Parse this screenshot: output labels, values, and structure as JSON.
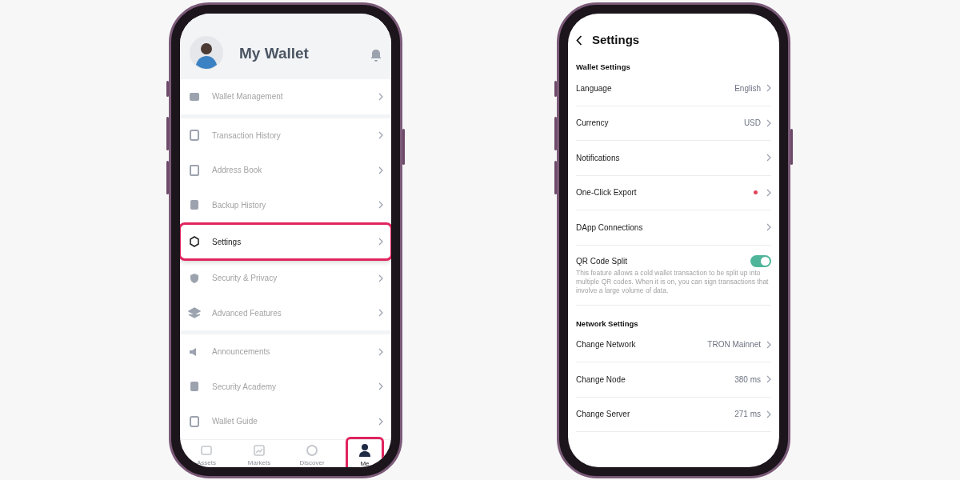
{
  "wallet_screen": {
    "title": "My Wallet",
    "items": [
      {
        "label": "Wallet Management",
        "selected": false,
        "group_end": true
      },
      {
        "label": "Transaction History",
        "selected": false,
        "group_end": false
      },
      {
        "label": "Address Book",
        "selected": false,
        "group_end": false
      },
      {
        "label": "Backup History",
        "selected": false,
        "group_end": false
      },
      {
        "label": "Settings",
        "selected": true,
        "group_end": false
      },
      {
        "label": "Security & Privacy",
        "selected": false,
        "group_end": false
      },
      {
        "label": "Advanced Features",
        "selected": false,
        "group_end": true
      },
      {
        "label": "Announcements",
        "selected": false,
        "group_end": false
      },
      {
        "label": "Security Academy",
        "selected": false,
        "group_end": false
      },
      {
        "label": "Wallet Guide",
        "selected": false,
        "group_end": false
      }
    ],
    "tabs": [
      {
        "label": "Assets",
        "selected": false
      },
      {
        "label": "Markets",
        "selected": false
      },
      {
        "label": "Discover",
        "selected": false
      },
      {
        "label": "Me",
        "selected": true
      }
    ]
  },
  "settings_screen": {
    "title": "Settings",
    "sections": [
      {
        "heading": "Wallet Settings",
        "rows": [
          {
            "kind": "link",
            "label": "Language",
            "value": "English"
          },
          {
            "kind": "link",
            "label": "Currency",
            "value": "USD"
          },
          {
            "kind": "link",
            "label": "Notifications"
          },
          {
            "kind": "dot",
            "label": "One-Click Export",
            "color": "#e0435a"
          },
          {
            "kind": "link",
            "label": "DApp Connections"
          },
          {
            "kind": "toggle",
            "label": "QR Code Split",
            "on": true,
            "description": "This feature allows a cold wallet transaction to be split up into multiple QR codes. When it is on, you can sign transactions that involve a large volume of data."
          }
        ]
      },
      {
        "heading": "Network Settings",
        "rows": [
          {
            "kind": "link",
            "label": "Change Network",
            "value": "TRON Mainnet"
          },
          {
            "kind": "link",
            "label": "Change Node",
            "value": "380 ms"
          },
          {
            "kind": "link",
            "label": "Change Server",
            "value": "271 ms"
          }
        ]
      }
    ]
  }
}
